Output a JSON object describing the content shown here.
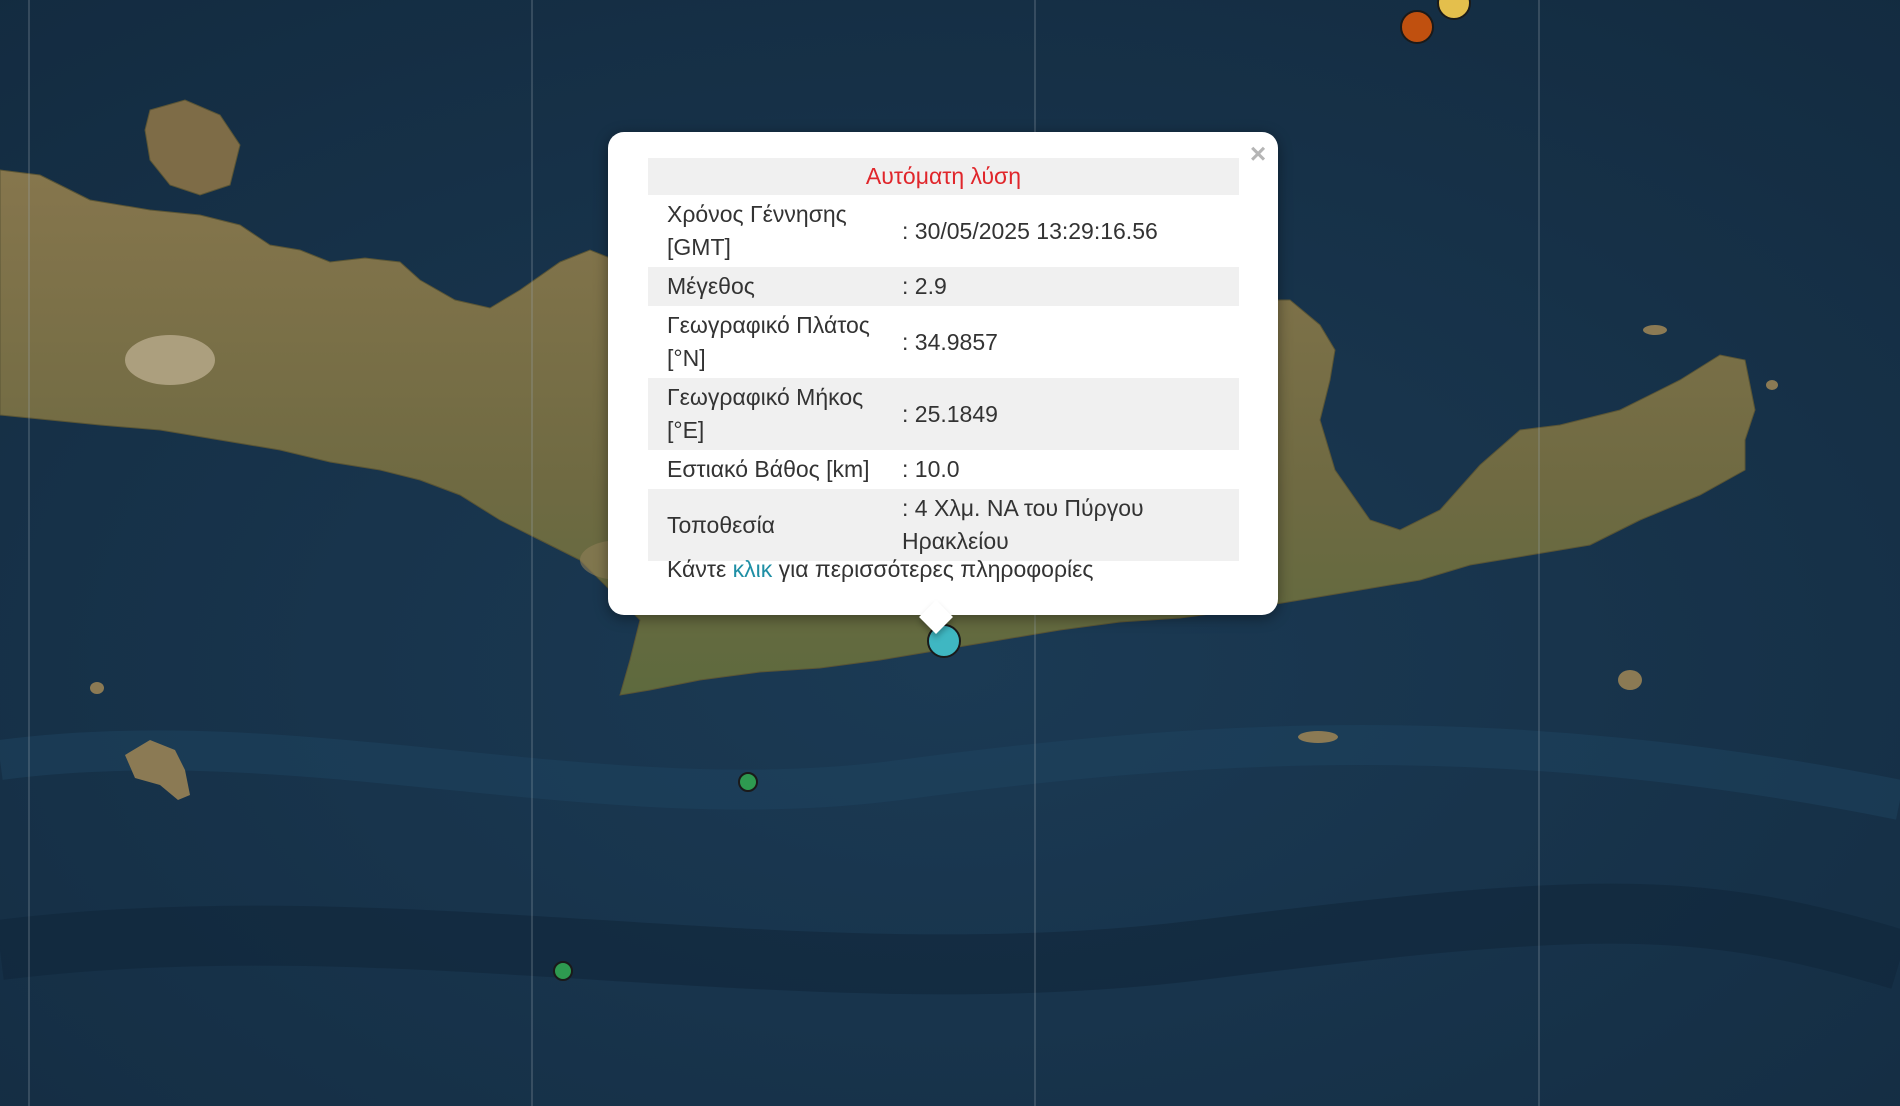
{
  "map": {
    "colors": {
      "sea": "#16324a",
      "land": "#7a6a45",
      "grid": "#9aa6b0"
    }
  },
  "markers": [
    {
      "name": "selected-quake",
      "color": "#3fb7c2",
      "selected": true
    },
    {
      "name": "quake-orange",
      "color": "#c0500f"
    },
    {
      "name": "quake-yellow",
      "color": "#e4bf4c"
    },
    {
      "name": "quake-green-1",
      "color": "#2e9a50"
    },
    {
      "name": "quake-green-2",
      "color": "#2e9a50"
    }
  ],
  "popup": {
    "title": "Αυτόματη λύση",
    "close_symbol": "×",
    "rows": [
      {
        "label": "Χρόνος Γέννησης [GMT]",
        "value": ": 30/05/2025 13:29:16.56"
      },
      {
        "label": "Μέγεθος",
        "value": ": 2.9"
      },
      {
        "label": "Γεωγραφικό Πλάτος [°N]",
        "value": ": 34.9857"
      },
      {
        "label": "Γεωγραφικό Μήκος [°E]",
        "value": ": 25.1849"
      },
      {
        "label": "Εστιακό Βάθος [km]",
        "value": ": 10.0"
      },
      {
        "label": "Τοποθεσία",
        "value": ": 4 Χλμ. ΝΑ του Πύργου Ηρακλείου"
      }
    ],
    "more_prefix": "Κάντε",
    "more_link": "κλικ",
    "more_suffix": "για περισσότερες πληροφορίες",
    "colors": {
      "title": "#e0262b",
      "link": "#1f8fa5"
    }
  }
}
